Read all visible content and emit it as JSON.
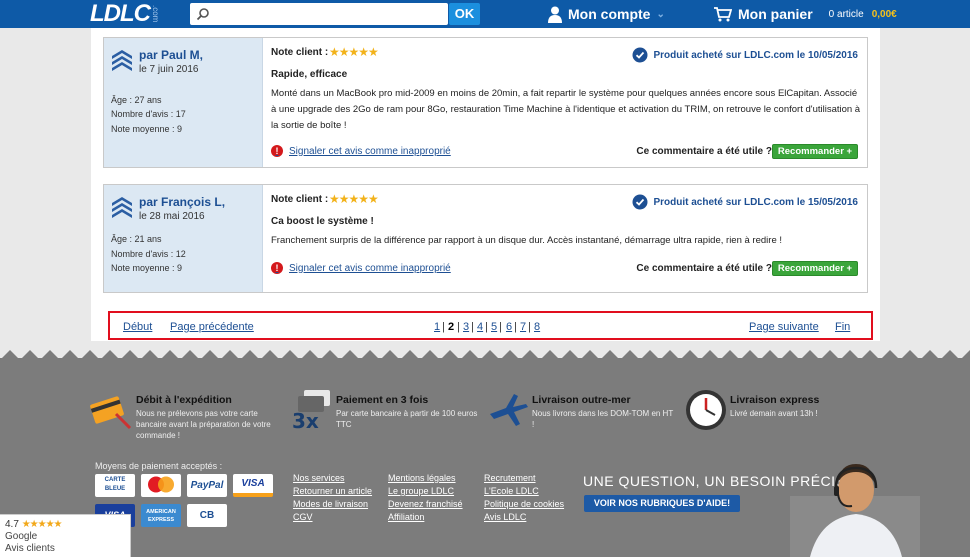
{
  "header": {
    "logo": "LDLC",
    "logo_sub": ".com",
    "search_placeholder": "",
    "search_button": "OK",
    "account_label": "Mon compte",
    "cart_label": "Mon panier",
    "cart_count": "0 article",
    "cart_total": "0,00€"
  },
  "reviews": [
    {
      "author": "par Paul M,",
      "date": "le 7 juin 2016",
      "age": "Âge : 27 ans",
      "review_count": "Nombre d'avis : 17",
      "average": "Note moyenne : 9",
      "note_label": "Note client :",
      "stars": "★★★★★",
      "verified": "Produit acheté sur LDLC.com le 10/05/2016",
      "title": "Rapide, efficace",
      "text": "Monté dans un MacBook pro mid-2009 en moins de 20min, a fait repartir le système pour quelques années encore sous ElCapitan. Associé à une upgrade des 2Go de ram pour 8Go, restauration Time Machine à l'identique et activation du TRIM, on retrouve le confort d'utilisation à la sortie de boîte !",
      "report": "Signaler cet avis comme inapproprié",
      "useful": "Ce commentaire a été utile ?",
      "recommend": "Recommander +"
    },
    {
      "author": "par François L,",
      "date": "le 28 mai 2016",
      "age": "Âge : 21 ans",
      "review_count": "Nombre d'avis : 12",
      "average": "Note moyenne : 9",
      "note_label": "Note client :",
      "stars": "★★★★★",
      "verified": "Produit acheté sur LDLC.com le 15/05/2016",
      "title": "Ca boost le système !",
      "text": "Franchement surpris de la différence par rapport à un disque dur. Accès instantané, démarrage ultra rapide, rien à redire !",
      "report": "Signaler cet avis comme inapproprié",
      "useful": "Ce commentaire a été utile ?",
      "recommend": "Recommander +"
    }
  ],
  "pagination": {
    "first": "Début",
    "prev": "Page précédente",
    "pages": [
      "1",
      "2",
      "3",
      "4",
      "5",
      "6",
      "7",
      "8"
    ],
    "current": "2",
    "next": "Page suivante",
    "last": "Fin"
  },
  "features": [
    {
      "title": "Débit à l'expédition",
      "desc": [
        "Nous ne prélevons pas votre carte",
        "bancaire avant la préparation de votre",
        "commande !"
      ],
      "icon": "credit-card-icon"
    },
    {
      "title": "Paiement en 3 fois",
      "desc": [
        "Par carte bancaire à partir de 100 euros",
        "TTC"
      ],
      "icon": "three-times-icon"
    },
    {
      "title": "Livraison outre-mer",
      "desc": [
        "Nous livrons dans les DOM-TOM en HT",
        "!"
      ],
      "icon": "airplane-icon"
    },
    {
      "title": "Livraison express",
      "desc": [
        "Livré demain avant 13h !"
      ],
      "icon": "clock-icon"
    }
  ],
  "payment": {
    "label": "Moyens de paiement acceptés :",
    "cards": [
      "CARTE BLEUE",
      "MasterCard",
      "PayPal",
      "VISA",
      "VISA",
      "AMERICAN EXPRESS",
      "CB"
    ]
  },
  "footer_links": [
    [
      "Nos services",
      "Retourner un article",
      "Modes de livraison",
      "CGV"
    ],
    [
      "Mentions légales",
      "Le groupe LDLC",
      "Devenez franchisé",
      "Affiliation"
    ],
    [
      "Recrutement",
      "L'Ecole LDLC",
      "Politique de cookies",
      "Avis LDLC"
    ]
  ],
  "help": {
    "question": "UNE QUESTION, UN BESOIN PRÉCIS ?",
    "button": "VOIR NOS RUBRIQUES D'AIDE!"
  },
  "google": {
    "rating": "4.7",
    "stars": "★★★★★",
    "name": "Google",
    "label": "Avis clients"
  }
}
